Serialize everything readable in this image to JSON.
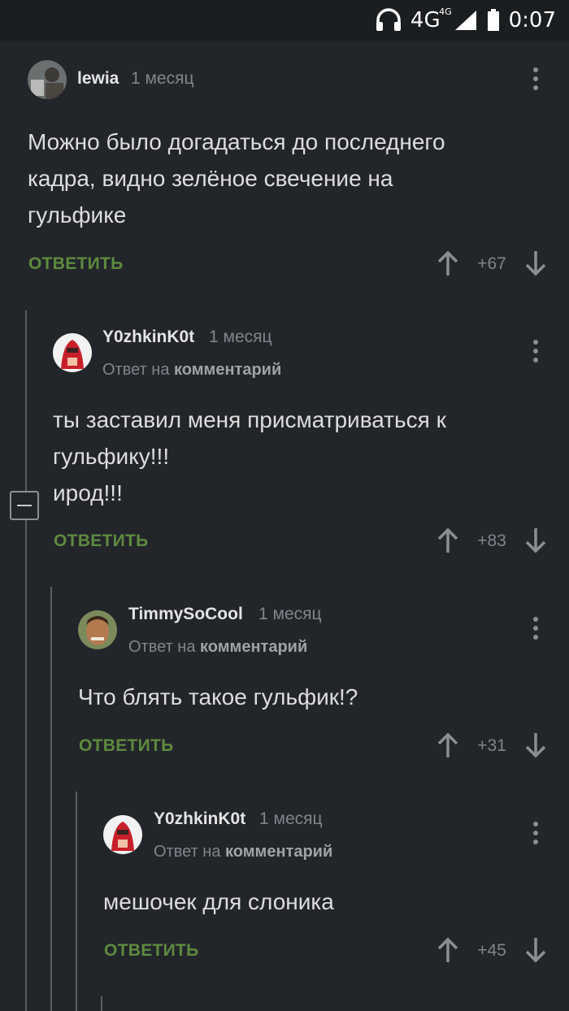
{
  "status_bar": {
    "network": "4G",
    "network_sup": "4G",
    "time": "0:07"
  },
  "comments": [
    {
      "author": "lewia",
      "time": "1 месяц",
      "text": [
        "Можно было догадаться до последнего",
        "кадра, видно зелёное свечение на",
        "гульфике"
      ],
      "reply_label": "ОТВЕТИТЬ",
      "score": "+67"
    },
    {
      "author": "Y0zhkinK0t",
      "time": "1 месяц",
      "reply_to_prefix": "Ответ на",
      "reply_to_link": "комментарий",
      "text": [
        "ты заставил меня присматриваться к",
        "гульфику!!!",
        "ирод!!!"
      ],
      "reply_label": "ОТВЕТИТЬ",
      "score": "+83"
    },
    {
      "author": "TimmySoCool",
      "time": "1 месяц",
      "reply_to_prefix": "Ответ на",
      "reply_to_link": "комментарий",
      "text": [
        "Что блять такое гульфик!?"
      ],
      "reply_label": "ОТВЕТИТЬ",
      "score": "+31"
    },
    {
      "author": "Y0zhkinK0t",
      "time": "1 месяц",
      "reply_to_prefix": "Ответ на",
      "reply_to_link": "комментарий",
      "text": [
        "мешочек для слоника"
      ],
      "reply_label": "ОТВЕТИТЬ",
      "score": "+45"
    }
  ],
  "colors": {
    "background": "#22262b",
    "answer": "#5f8a3e",
    "muted": "#80858b"
  }
}
